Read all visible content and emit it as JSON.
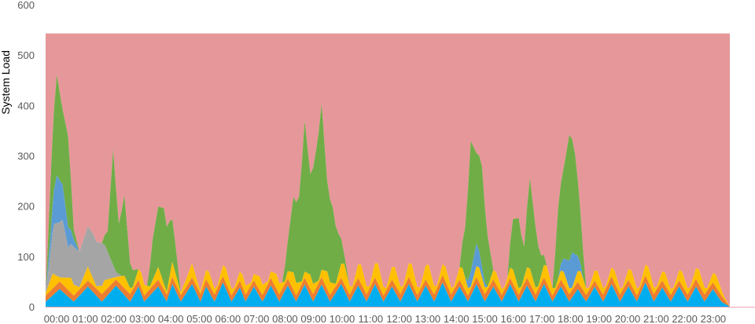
{
  "chart_data": {
    "type": "area",
    "stacked": true,
    "title": "",
    "xlabel": "",
    "ylabel": "System Load",
    "ylim": [
      0,
      600
    ],
    "yticks": [
      0,
      100,
      200,
      300,
      400,
      500,
      600
    ],
    "xticks": [
      "00:00",
      "01:00",
      "02:00",
      "03:00",
      "04:00",
      "05:00",
      "06:00",
      "07:00",
      "08:00",
      "09:00",
      "10:00",
      "11:00",
      "12:00",
      "13:00",
      "14:00",
      "15:00",
      "16:00",
      "17:00",
      "18:00",
      "19:00",
      "20:00",
      "21:00",
      "22:00",
      "23:00"
    ],
    "xlim": [
      0,
      24.3
    ],
    "grid": false,
    "legend": "none",
    "background": "#ffffff",
    "axis_color": "#f4a6b6",
    "series": [
      {
        "color": "#00aeef",
        "points": [
          [
            0,
            10
          ],
          [
            0.5,
            35
          ],
          [
            1,
            10
          ],
          [
            1.5,
            40
          ],
          [
            2,
            10
          ],
          [
            2.5,
            42
          ],
          [
            3,
            10
          ],
          [
            3.3,
            40
          ],
          [
            3.5,
            10
          ],
          [
            4,
            40
          ],
          [
            4.3,
            10
          ],
          [
            4.5,
            45
          ],
          [
            4.8,
            10
          ],
          [
            5.2,
            45
          ],
          [
            5.5,
            10
          ],
          [
            5.7,
            40
          ],
          [
            6,
            10
          ],
          [
            6.3,
            48
          ],
          [
            6.6,
            10
          ],
          [
            6.9,
            38
          ],
          [
            7.1,
            10
          ],
          [
            7.4,
            40
          ],
          [
            7.7,
            10
          ],
          [
            8,
            42
          ],
          [
            8.3,
            10
          ],
          [
            8.6,
            42
          ],
          [
            8.9,
            10
          ],
          [
            9.2,
            44
          ],
          [
            9.5,
            10
          ],
          [
            9.8,
            44
          ],
          [
            10.1,
            10
          ],
          [
            10.5,
            45
          ],
          [
            10.8,
            10
          ],
          [
            11.1,
            42
          ],
          [
            11.4,
            10
          ],
          [
            11.7,
            45
          ],
          [
            12,
            10
          ],
          [
            12.3,
            40
          ],
          [
            12.6,
            10
          ],
          [
            12.9,
            45
          ],
          [
            13.2,
            10
          ],
          [
            13.5,
            42
          ],
          [
            13.8,
            10
          ],
          [
            14.1,
            48
          ],
          [
            14.4,
            10
          ],
          [
            14.7,
            40
          ],
          [
            15,
            10
          ],
          [
            15.3,
            45
          ],
          [
            15.6,
            10
          ],
          [
            15.9,
            40
          ],
          [
            16.2,
            10
          ],
          [
            16.5,
            45
          ],
          [
            16.8,
            10
          ],
          [
            17.1,
            42
          ],
          [
            17.4,
            10
          ],
          [
            17.7,
            45
          ],
          [
            18,
            10
          ],
          [
            18.3,
            40
          ],
          [
            18.6,
            10
          ],
          [
            18.9,
            35
          ],
          [
            19.2,
            10
          ],
          [
            19.5,
            40
          ],
          [
            19.8,
            10
          ],
          [
            20.1,
            45
          ],
          [
            20.4,
            10
          ],
          [
            20.7,
            40
          ],
          [
            21,
            10
          ],
          [
            21.3,
            48
          ],
          [
            21.6,
            10
          ],
          [
            21.9,
            38
          ],
          [
            22.2,
            10
          ],
          [
            22.5,
            40
          ],
          [
            22.8,
            10
          ],
          [
            23.1,
            40
          ],
          [
            23.4,
            10
          ],
          [
            23.7,
            35
          ],
          [
            24,
            10
          ],
          [
            24.3,
            0
          ]
        ]
      },
      {
        "color": "#ed7d31",
        "points": [
          [
            0,
            12
          ],
          [
            0.5,
            15
          ],
          [
            1,
            12
          ],
          [
            1.5,
            12
          ],
          [
            2,
            15
          ],
          [
            2.5,
            12
          ],
          [
            3,
            15
          ],
          [
            3.5,
            12
          ],
          [
            4,
            14
          ],
          [
            4.5,
            14
          ],
          [
            5,
            12
          ],
          [
            5.5,
            15
          ],
          [
            6,
            14
          ],
          [
            6.5,
            12
          ],
          [
            7,
            14
          ],
          [
            7.5,
            12
          ],
          [
            8,
            15
          ],
          [
            8.5,
            14
          ],
          [
            9,
            12
          ],
          [
            9.5,
            15
          ],
          [
            10,
            14
          ],
          [
            10.5,
            12
          ],
          [
            11,
            15
          ],
          [
            11.5,
            14
          ],
          [
            12,
            12
          ],
          [
            12.5,
            15
          ],
          [
            13,
            14
          ],
          [
            13.5,
            12
          ],
          [
            14,
            15
          ],
          [
            14.5,
            14
          ],
          [
            15,
            12
          ],
          [
            15.5,
            15
          ],
          [
            16,
            14
          ],
          [
            16.5,
            12
          ],
          [
            17,
            15
          ],
          [
            17.5,
            14
          ],
          [
            18,
            12
          ],
          [
            18.5,
            15
          ],
          [
            19,
            14
          ],
          [
            19.5,
            12
          ],
          [
            20,
            15
          ],
          [
            20.5,
            14
          ],
          [
            21,
            12
          ],
          [
            21.5,
            15
          ],
          [
            22,
            14
          ],
          [
            22.5,
            12
          ],
          [
            23,
            15
          ],
          [
            23.5,
            14
          ],
          [
            24,
            12
          ],
          [
            24.3,
            0
          ]
        ]
      },
      {
        "color": "#ffc000",
        "points": [
          [
            0,
            5
          ],
          [
            0.25,
            30
          ],
          [
            0.5,
            8
          ],
          [
            0.9,
            30
          ],
          [
            1.2,
            5
          ],
          [
            1.5,
            28
          ],
          [
            1.8,
            5
          ],
          [
            2.1,
            22
          ],
          [
            2.5,
            5
          ],
          [
            2.8,
            25
          ],
          [
            3.1,
            5
          ],
          [
            3.4,
            30
          ],
          [
            3.7,
            5
          ],
          [
            4,
            25
          ],
          [
            4.3,
            5
          ],
          [
            4.5,
            30
          ],
          [
            4.8,
            5
          ],
          [
            5.2,
            28
          ],
          [
            5.5,
            5
          ],
          [
            5.8,
            25
          ],
          [
            6.1,
            5
          ],
          [
            6.4,
            30
          ],
          [
            6.7,
            5
          ],
          [
            7,
            25
          ],
          [
            7.3,
            5
          ],
          [
            7.6,
            28
          ],
          [
            7.9,
            5
          ],
          [
            8.2,
            30
          ],
          [
            8.5,
            5
          ],
          [
            8.8,
            35
          ],
          [
            9.1,
            5
          ],
          [
            9.4,
            28
          ],
          [
            9.7,
            5
          ],
          [
            10,
            35
          ],
          [
            10.3,
            5
          ],
          [
            10.6,
            40
          ],
          [
            10.9,
            5
          ],
          [
            11.2,
            38
          ],
          [
            11.5,
            5
          ],
          [
            11.8,
            40
          ],
          [
            12.1,
            5
          ],
          [
            12.4,
            35
          ],
          [
            12.7,
            5
          ],
          [
            13,
            38
          ],
          [
            13.3,
            5
          ],
          [
            13.6,
            40
          ],
          [
            13.9,
            5
          ],
          [
            14.2,
            30
          ],
          [
            14.5,
            5
          ],
          [
            14.8,
            35
          ],
          [
            15.1,
            5
          ],
          [
            15.4,
            30
          ],
          [
            15.7,
            5
          ],
          [
            16,
            25
          ],
          [
            16.3,
            5
          ],
          [
            16.6,
            28
          ],
          [
            16.9,
            5
          ],
          [
            17.2,
            30
          ],
          [
            17.5,
            5
          ],
          [
            17.8,
            35
          ],
          [
            18.1,
            5
          ],
          [
            18.4,
            25
          ],
          [
            18.7,
            5
          ],
          [
            19,
            30
          ],
          [
            19.3,
            5
          ],
          [
            19.6,
            28
          ],
          [
            19.9,
            5
          ],
          [
            20.2,
            25
          ],
          [
            20.5,
            5
          ],
          [
            20.8,
            30
          ],
          [
            21.1,
            5
          ],
          [
            21.4,
            30
          ],
          [
            21.7,
            5
          ],
          [
            22,
            25
          ],
          [
            22.3,
            5
          ],
          [
            22.6,
            28
          ],
          [
            22.9,
            5
          ],
          [
            23.2,
            30
          ],
          [
            23.5,
            5
          ],
          [
            23.8,
            25
          ],
          [
            24.1,
            5
          ],
          [
            24.3,
            0
          ]
        ]
      },
      {
        "color": "#a5a5a5",
        "points": [
          [
            0,
            0
          ],
          [
            0.1,
            30
          ],
          [
            0.3,
            100
          ],
          [
            0.6,
            115
          ],
          [
            0.8,
            60
          ],
          [
            1,
            75
          ],
          [
            1.2,
            70
          ],
          [
            1.5,
            80
          ],
          [
            1.7,
            90
          ],
          [
            2,
            85
          ],
          [
            2.3,
            40
          ],
          [
            2.5,
            10
          ],
          [
            2.7,
            0
          ],
          [
            24.3,
            0
          ]
        ]
      },
      {
        "color": "#5b9bd5",
        "points": [
          [
            0,
            0
          ],
          [
            0.2,
            40
          ],
          [
            0.4,
            95
          ],
          [
            0.6,
            70
          ],
          [
            0.8,
            40
          ],
          [
            1,
            15
          ],
          [
            1.2,
            0
          ],
          [
            14.9,
            0
          ],
          [
            15.1,
            30
          ],
          [
            15.3,
            45
          ],
          [
            15.5,
            20
          ],
          [
            15.7,
            0
          ],
          [
            18.2,
            0
          ],
          [
            18.5,
            40
          ],
          [
            18.7,
            70
          ],
          [
            18.9,
            30
          ],
          [
            19.1,
            0
          ],
          [
            24.3,
            0
          ]
        ]
      },
      {
        "color": "#70ad47",
        "points": [
          [
            0,
            0
          ],
          [
            0.2,
            120
          ],
          [
            0.4,
            200
          ],
          [
            0.6,
            150
          ],
          [
            0.8,
            180
          ],
          [
            1,
            20
          ],
          [
            1.2,
            0
          ],
          [
            2,
            0
          ],
          [
            2.2,
            40
          ],
          [
            2.4,
            230
          ],
          [
            2.6,
            100
          ],
          [
            2.8,
            160
          ],
          [
            3,
            50
          ],
          [
            3.3,
            0
          ],
          [
            3.6,
            0
          ],
          [
            3.8,
            80
          ],
          [
            4,
            120
          ],
          [
            4.2,
            150
          ],
          [
            4.4,
            110
          ],
          [
            4.6,
            60
          ],
          [
            4.8,
            0
          ],
          [
            8.4,
            0
          ],
          [
            8.6,
            60
          ],
          [
            8.8,
            150
          ],
          [
            9,
            170
          ],
          [
            9.2,
            300
          ],
          [
            9.4,
            200
          ],
          [
            9.6,
            260
          ],
          [
            9.8,
            330
          ],
          [
            10,
            180
          ],
          [
            10.2,
            150
          ],
          [
            10.4,
            80
          ],
          [
            10.6,
            20
          ],
          [
            10.8,
            0
          ],
          [
            14.7,
            0
          ],
          [
            14.9,
            100
          ],
          [
            15.1,
            260
          ],
          [
            15.3,
            180
          ],
          [
            15.5,
            200
          ],
          [
            15.7,
            100
          ],
          [
            15.9,
            0
          ],
          [
            16.4,
            0
          ],
          [
            16.6,
            100
          ],
          [
            16.8,
            140
          ],
          [
            17,
            60
          ],
          [
            17.2,
            180
          ],
          [
            17.4,
            120
          ],
          [
            17.6,
            40
          ],
          [
            17.8,
            0
          ],
          [
            18,
            0
          ],
          [
            18.2,
            140
          ],
          [
            18.4,
            180
          ],
          [
            18.6,
            250
          ],
          [
            18.8,
            200
          ],
          [
            19,
            100
          ],
          [
            19.2,
            0
          ],
          [
            24.3,
            0
          ]
        ]
      },
      {
        "color": "#e6979a",
        "fill_to_top": 543,
        "points": [
          [
            0,
            543
          ],
          [
            24.3,
            543
          ]
        ]
      }
    ]
  }
}
